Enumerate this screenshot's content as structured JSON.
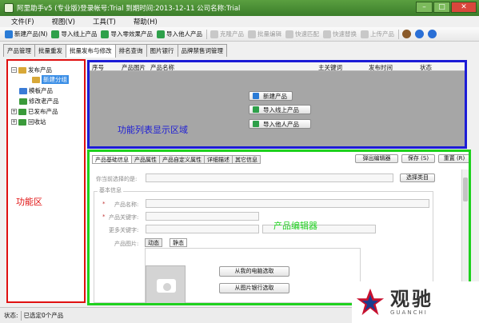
{
  "window": {
    "title": "阿里助手v5 (专业版)登录帐号:Trial  到期时间:2013-12-11   公司名称:Trial",
    "minimize": "–",
    "maximize": "□",
    "close": "✕"
  },
  "menu": [
    "文件(F)",
    "视图(V)",
    "工具(T)",
    "帮助(H)"
  ],
  "toolbar": [
    {
      "label": "新建产品(N)",
      "color": "#2a7bd6",
      "disabled": false
    },
    {
      "label": "导入线上产品",
      "color": "#2ea04a",
      "disabled": false
    },
    {
      "label": "导入零效果产品",
      "color": "#2ea04a",
      "disabled": false
    },
    {
      "label": "导入他人产品",
      "color": "#2ea04a",
      "disabled": false
    },
    {
      "label": "克隆产品",
      "color": "#c8c8c8",
      "disabled": true
    },
    {
      "label": "批量编辑",
      "color": "#c8c8c8",
      "disabled": true
    },
    {
      "label": "快速匹配",
      "color": "#c8c8c8",
      "disabled": true
    },
    {
      "label": "快速替换",
      "color": "#c8c8c8",
      "disabled": true
    },
    {
      "label": "上传产品",
      "color": "#c8c8c8",
      "disabled": true
    }
  ],
  "toolbar_tools": [
    {
      "name": "tools-icon",
      "color": "#8a5a2a"
    },
    {
      "name": "help-icon",
      "color": "#2a6fd6"
    },
    {
      "name": "info-icon",
      "color": "#2a6fd6"
    }
  ],
  "tabs": [
    "产品管理",
    "批量重发",
    "批量发布与修改",
    "排名查询",
    "图片银行",
    "品牌禁售词管理"
  ],
  "active_tab": 2,
  "tree": [
    {
      "label": "发布产品",
      "expander": "−",
      "color": "#d8a838"
    },
    {
      "label": "新建分组",
      "color": "#d8a838"
    },
    {
      "label": "模板产品",
      "color": "#3a7bd6"
    },
    {
      "label": "修改老产品",
      "color": "#3a9a3a"
    },
    {
      "label": "已发布产品",
      "expander": "+",
      "color": "#3a9a3a"
    },
    {
      "label": "回收站",
      "expander": "+",
      "color": "#3a9a3a"
    }
  ],
  "labels": {
    "function_area": "功能区",
    "list_area": "功能列表显示区域",
    "editor_area": "产品编辑器"
  },
  "label_colors": {
    "function_area": "#e01010",
    "list_area": "#1c1cd6",
    "editor_area": "#1ed11e"
  },
  "list": {
    "columns": [
      "序号",
      "产品图片",
      "产品名称",
      "主关键词",
      "发布时间",
      "状态"
    ],
    "actions": [
      "新建产品",
      "导入线上产品",
      "导入他人产品"
    ]
  },
  "editor": {
    "tabs": [
      "产品基础信息",
      "产品属性",
      "产品自定义属性",
      "详细描述",
      "其它信息"
    ],
    "popup_button": "弹出编辑器",
    "save_button": "保存 (S)",
    "reset_button": "重置 (R)",
    "category_label": "你当前选择的是:",
    "choose_category": "选择类目",
    "basic_info": "基本信息",
    "name_label": "产品名称:",
    "keyword_label": "产品关键字:",
    "more_keywords_label": "更多关键字:",
    "image_label": "产品图片:",
    "image_tabs": [
      "动态",
      "静态"
    ],
    "from_computer": "从我的电脑选取",
    "from_bank": "从图片银行选取",
    "required_mark": "*"
  },
  "status": {
    "label": "状态:",
    "text": "已选定0个产品"
  },
  "watermark": {
    "cn": "观驰",
    "en": "GUANCHI"
  }
}
